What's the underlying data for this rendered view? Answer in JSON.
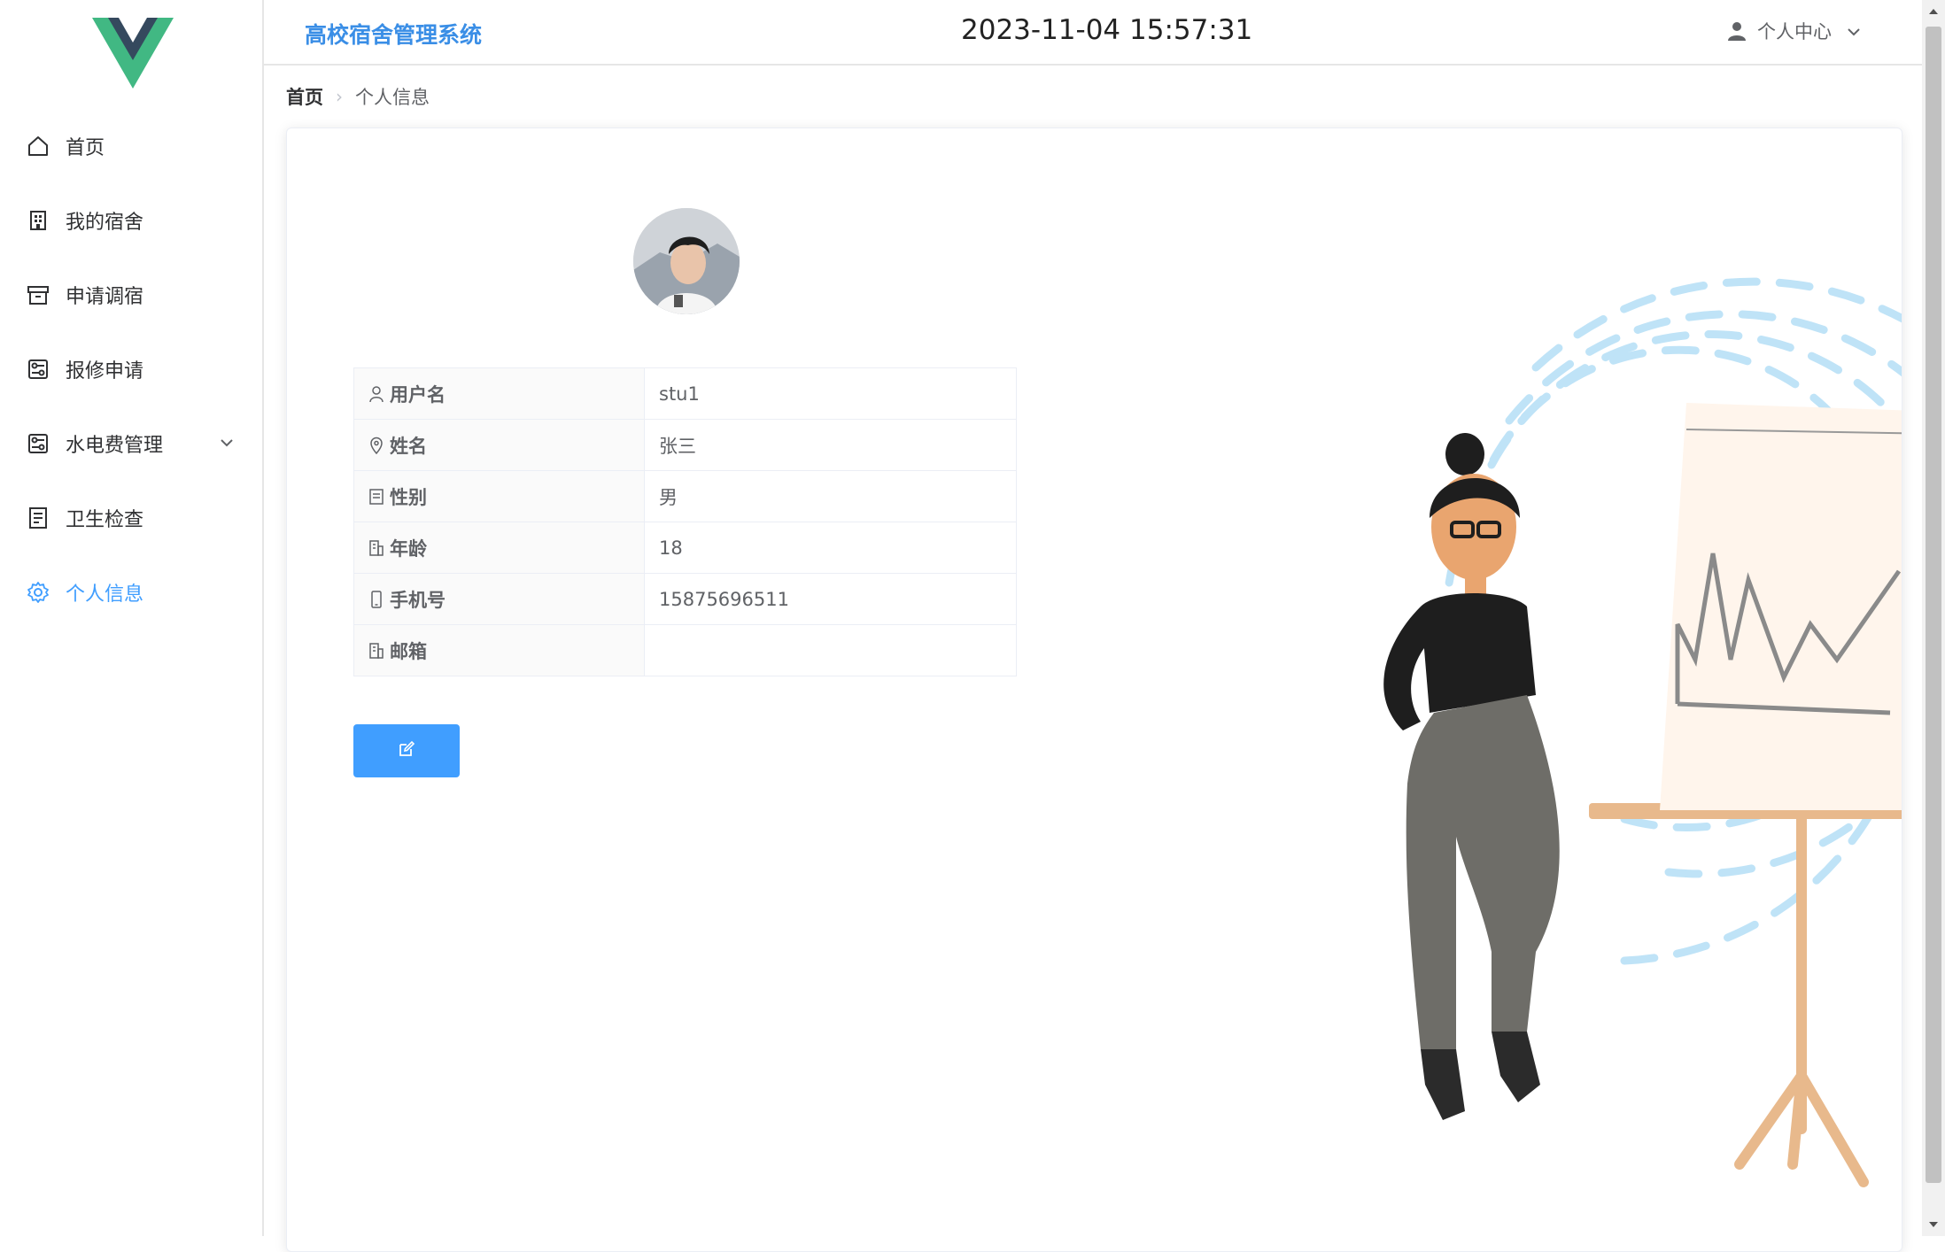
{
  "header": {
    "system_title": "高校宿舍管理系统",
    "datetime": "2023-11-04 15:57:31",
    "user_menu_label": "个人中心"
  },
  "sidebar": {
    "items": [
      {
        "label": "首页",
        "icon": "home-icon"
      },
      {
        "label": "我的宿舍",
        "icon": "building-icon"
      },
      {
        "label": "申请调宿",
        "icon": "box-icon"
      },
      {
        "label": "报修申请",
        "icon": "tools-icon"
      },
      {
        "label": "水电费管理",
        "icon": "tools-icon",
        "has_submenu": true
      },
      {
        "label": "卫生检查",
        "icon": "document-icon"
      },
      {
        "label": "个人信息",
        "icon": "gear-icon",
        "active": true
      }
    ]
  },
  "breadcrumb": {
    "home": "首页",
    "current": "个人信息"
  },
  "profile": {
    "fields": [
      {
        "label": "用户名",
        "value": "stu1",
        "icon": "user-icon"
      },
      {
        "label": "姓名",
        "value": "张三",
        "icon": "location-icon"
      },
      {
        "label": "性别",
        "value": "男",
        "icon": "tickets-icon"
      },
      {
        "label": "年龄",
        "value": "18",
        "icon": "office-building-icon"
      },
      {
        "label": "手机号",
        "value": "15875696511",
        "icon": "mobile-icon"
      },
      {
        "label": "邮箱",
        "value": "",
        "icon": "office-building-icon"
      }
    ],
    "edit_button_icon": "edit-icon"
  },
  "colors": {
    "accent": "#409eff",
    "title": "#3a8ee6",
    "logo_green": "#41b883",
    "logo_dark": "#35495e"
  }
}
